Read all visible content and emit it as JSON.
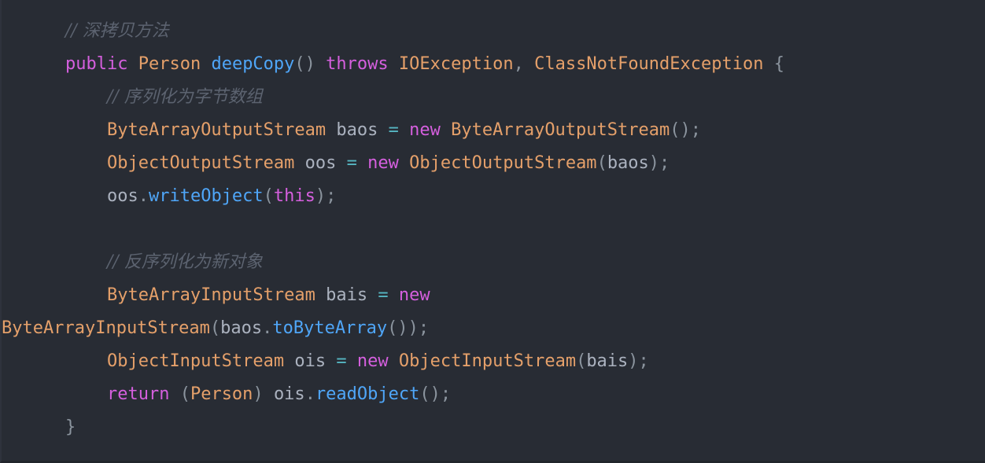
{
  "editor": {
    "name": "code-viewer",
    "language": "java",
    "theme": "one-dark",
    "background_color": "#282c34",
    "colors": {
      "background": "#282c34",
      "comment": "#5c6370",
      "keyword": "#d55fde",
      "type": "#e5a06a",
      "function": "#4fa6f8",
      "variable": "#abb2bf",
      "punctuation": "#8b949e",
      "operator": "#56b6c2",
      "border_bottom": "#21252b"
    }
  },
  "code": {
    "lines": [
      {
        "id": "line-comment-deepcopy",
        "indent": 1,
        "wrapped": false,
        "tokens": [
          {
            "type": "comment",
            "text": "// 深拷贝方法"
          }
        ]
      },
      {
        "id": "line-method-signature",
        "indent": 1,
        "wrapped": false,
        "tokens": [
          {
            "type": "keyword",
            "text": "public"
          },
          {
            "type": "plain",
            "text": " "
          },
          {
            "type": "type",
            "text": "Person"
          },
          {
            "type": "plain",
            "text": " "
          },
          {
            "type": "func",
            "text": "deepCopy"
          },
          {
            "type": "punct",
            "text": "()"
          },
          {
            "type": "plain",
            "text": " "
          },
          {
            "type": "keyword",
            "text": "throws"
          },
          {
            "type": "plain",
            "text": " "
          },
          {
            "type": "type",
            "text": "IOException"
          },
          {
            "type": "punct",
            "text": ","
          },
          {
            "type": "plain",
            "text": " "
          },
          {
            "type": "type",
            "text": "ClassNotFoundException"
          },
          {
            "type": "plain",
            "text": " "
          },
          {
            "type": "brace",
            "text": "{"
          }
        ]
      },
      {
        "id": "line-comment-serialize",
        "indent": 2,
        "wrapped": false,
        "tokens": [
          {
            "type": "comment",
            "text": "// 序列化为字节数组"
          }
        ]
      },
      {
        "id": "line-baos-decl",
        "indent": 2,
        "wrapped": false,
        "tokens": [
          {
            "type": "type",
            "text": "ByteArrayOutputStream"
          },
          {
            "type": "plain",
            "text": " "
          },
          {
            "type": "var",
            "text": "baos"
          },
          {
            "type": "plain",
            "text": " "
          },
          {
            "type": "operator",
            "text": "="
          },
          {
            "type": "plain",
            "text": " "
          },
          {
            "type": "keyword",
            "text": "new"
          },
          {
            "type": "plain",
            "text": " "
          },
          {
            "type": "type",
            "text": "ByteArrayOutputStream"
          },
          {
            "type": "punct",
            "text": "();"
          }
        ]
      },
      {
        "id": "line-oos-decl",
        "indent": 2,
        "wrapped": false,
        "tokens": [
          {
            "type": "type",
            "text": "ObjectOutputStream"
          },
          {
            "type": "plain",
            "text": " "
          },
          {
            "type": "var",
            "text": "oos"
          },
          {
            "type": "plain",
            "text": " "
          },
          {
            "type": "operator",
            "text": "="
          },
          {
            "type": "plain",
            "text": " "
          },
          {
            "type": "keyword",
            "text": "new"
          },
          {
            "type": "plain",
            "text": " "
          },
          {
            "type": "type",
            "text": "ObjectOutputStream"
          },
          {
            "type": "punct",
            "text": "("
          },
          {
            "type": "var",
            "text": "baos"
          },
          {
            "type": "punct",
            "text": ");"
          }
        ]
      },
      {
        "id": "line-write-object",
        "indent": 2,
        "wrapped": false,
        "tokens": [
          {
            "type": "var",
            "text": "oos"
          },
          {
            "type": "punct",
            "text": "."
          },
          {
            "type": "func",
            "text": "writeObject"
          },
          {
            "type": "punct",
            "text": "("
          },
          {
            "type": "keyword",
            "text": "this"
          },
          {
            "type": "punct",
            "text": ");"
          }
        ]
      },
      {
        "id": "line-blank-1",
        "indent": 0,
        "wrapped": false,
        "tokens": []
      },
      {
        "id": "line-comment-deserialize",
        "indent": 2,
        "wrapped": false,
        "tokens": [
          {
            "type": "comment",
            "text": "// 反序列化为新对象"
          }
        ]
      },
      {
        "id": "line-bais-decl",
        "indent": 2,
        "wrapped": false,
        "tokens": [
          {
            "type": "type",
            "text": "ByteArrayInputStream"
          },
          {
            "type": "plain",
            "text": " "
          },
          {
            "type": "var",
            "text": "bais"
          },
          {
            "type": "plain",
            "text": " "
          },
          {
            "type": "operator",
            "text": "="
          },
          {
            "type": "plain",
            "text": " "
          },
          {
            "type": "keyword",
            "text": "new"
          }
        ]
      },
      {
        "id": "line-bais-decl-wrap",
        "indent": 0,
        "wrapped": true,
        "tokens": [
          {
            "type": "type",
            "text": "ByteArrayInputStream"
          },
          {
            "type": "punct",
            "text": "("
          },
          {
            "type": "var",
            "text": "baos"
          },
          {
            "type": "punct",
            "text": "."
          },
          {
            "type": "func",
            "text": "toByteArray"
          },
          {
            "type": "punct",
            "text": "());"
          }
        ]
      },
      {
        "id": "line-ois-decl",
        "indent": 2,
        "wrapped": false,
        "tokens": [
          {
            "type": "type",
            "text": "ObjectInputStream"
          },
          {
            "type": "plain",
            "text": " "
          },
          {
            "type": "var",
            "text": "ois"
          },
          {
            "type": "plain",
            "text": " "
          },
          {
            "type": "operator",
            "text": "="
          },
          {
            "type": "plain",
            "text": " "
          },
          {
            "type": "keyword",
            "text": "new"
          },
          {
            "type": "plain",
            "text": " "
          },
          {
            "type": "type",
            "text": "ObjectInputStream"
          },
          {
            "type": "punct",
            "text": "("
          },
          {
            "type": "var",
            "text": "bais"
          },
          {
            "type": "punct",
            "text": ");"
          }
        ]
      },
      {
        "id": "line-return",
        "indent": 2,
        "wrapped": false,
        "tokens": [
          {
            "type": "keyword",
            "text": "return"
          },
          {
            "type": "plain",
            "text": " "
          },
          {
            "type": "punct",
            "text": "("
          },
          {
            "type": "type",
            "text": "Person"
          },
          {
            "type": "punct",
            "text": ")"
          },
          {
            "type": "plain",
            "text": " "
          },
          {
            "type": "var",
            "text": "ois"
          },
          {
            "type": "punct",
            "text": "."
          },
          {
            "type": "func",
            "text": "readObject"
          },
          {
            "type": "punct",
            "text": "();"
          }
        ]
      },
      {
        "id": "line-close-brace",
        "indent": 1,
        "wrapped": false,
        "tokens": [
          {
            "type": "brace",
            "text": "}"
          }
        ]
      }
    ]
  }
}
